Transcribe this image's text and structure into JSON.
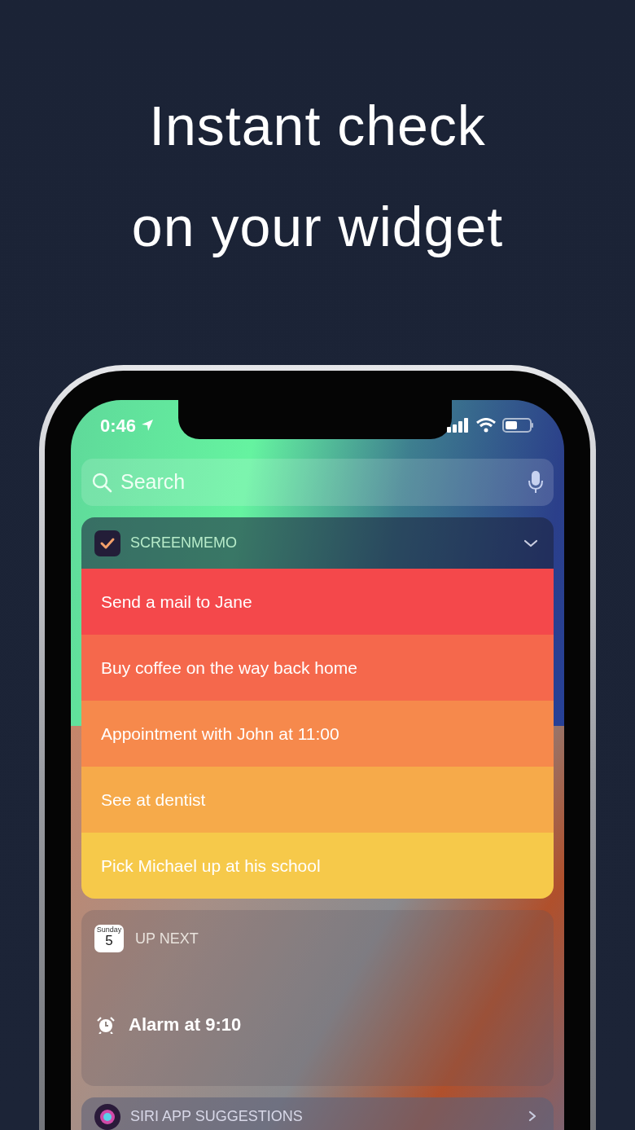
{
  "headline": [
    "Instant check",
    "on your widget"
  ],
  "status_bar": {
    "time": "0:46"
  },
  "search": {
    "placeholder": "Search"
  },
  "memo_widget": {
    "title": "SCREENMEMO",
    "expanded": false,
    "tasks": [
      {
        "text": "Send a mail to Jane",
        "color": "#f4484b"
      },
      {
        "text": "Buy coffee on the way back home",
        "color": "#f5684c"
      },
      {
        "text": "Appointment with John at 11:00",
        "color": "#f6894c"
      },
      {
        "text": "See at dentist",
        "color": "#f6aa4a"
      },
      {
        "text": "Pick Michael up at his school",
        "color": "#f6c94a"
      }
    ]
  },
  "up_next_widget": {
    "title": "UP NEXT",
    "calendar_icon": {
      "weekday": "Sunday",
      "day": "5"
    },
    "event": "Alarm at 9:10"
  },
  "siri_widget": {
    "title": "SIRI APP SUGGESTIONS"
  }
}
